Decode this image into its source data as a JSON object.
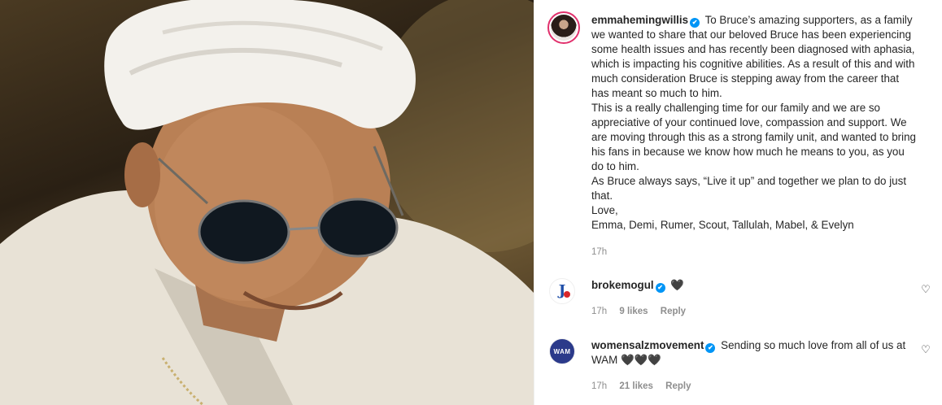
{
  "post": {
    "image_alt_icon": "post-photo",
    "author": "emmahemingwillis",
    "caption_lines": [
      "To Bruce’s amazing supporters, as a family we wanted to share that our beloved Bruce has been experiencing some health issues and has recently been diagnosed with aphasia, which is impacting his cognitive abilities. As a result of this and with much consideration Bruce is stepping away from the career that has meant so much to him.",
      "This is a really challenging time for our family and we are so appreciative of your continued love, compassion and support. We are moving through this as a strong family unit, and wanted to bring his fans in because we know how much he means to you, as you do to him.",
      "As Bruce always says, “Live it up” and together we plan to do just that.",
      "Love,",
      "Emma, Demi, Rumer, Scout, Tallulah, Mabel, & Evelyn"
    ],
    "time": "17h"
  },
  "comments": [
    {
      "username": "brokemogul",
      "text": "🖤",
      "time": "17h",
      "likes": "9 likes",
      "reply": "Reply"
    },
    {
      "username": "womensalzmovement",
      "text": "Sending so much love from all of us at WAM 🖤🖤🖤",
      "time": "17h",
      "likes": "21 likes",
      "reply": "Reply",
      "avatar_text": "WAM"
    }
  ],
  "icons": {
    "verified": "✔",
    "like": "♡"
  },
  "colors": {
    "verified_blue": "#0095f6",
    "text": "#262626",
    "muted": "#8e8e8e"
  }
}
